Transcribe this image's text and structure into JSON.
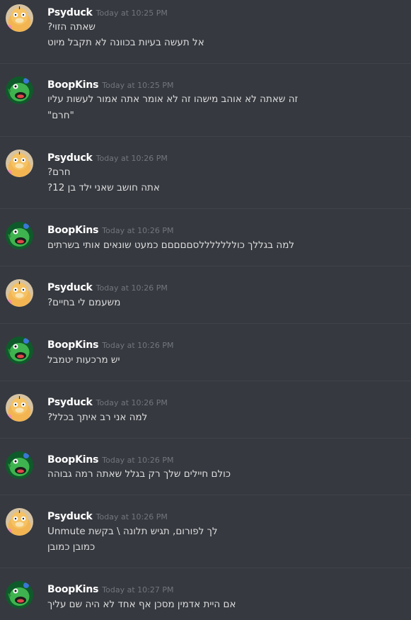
{
  "messages": [
    {
      "author": "Psyduck",
      "timestamp": "Today at 10:25 PM",
      "avatar": "psyduck-avatar",
      "lines": [
        "?שאתה הזוי",
        "אל תעשה בעיות בכוונה לא תקבל מיוט"
      ]
    },
    {
      "author": "BoopKins",
      "timestamp": "Today at 10:25 PM",
      "avatar": "green-dragon-avatar",
      "lines": [
        "זה שאתה לא אוהב מישהו זה לא אומר אתה אמור לעשות עליו",
        "\"חרם\""
      ]
    },
    {
      "author": "Psyduck",
      "timestamp": "Today at 10:26 PM",
      "avatar": "psyduck-avatar",
      "lines": [
        "?חרם",
        "?אתה חושב שאני ילד בן 12"
      ]
    },
    {
      "author": "BoopKins",
      "timestamp": "Today at 10:26 PM",
      "avatar": "green-dragon-avatar",
      "lines": [
        "למה בגללך כולללללללסםםםםם כמעט שונאים אותי בשרתים"
      ]
    },
    {
      "author": "Psyduck",
      "timestamp": "Today at 10:26 PM",
      "avatar": "psyduck-avatar",
      "lines": [
        "?משעמם לי בחיים"
      ]
    },
    {
      "author": "BoopKins",
      "timestamp": "Today at 10:26 PM",
      "avatar": "green-dragon-avatar",
      "lines": [
        "יש מרכעות יטמבל"
      ]
    },
    {
      "author": "Psyduck",
      "timestamp": "Today at 10:26 PM",
      "avatar": "psyduck-avatar",
      "lines": [
        "?למה אני רב איתך בכלל"
      ]
    },
    {
      "author": "BoopKins",
      "timestamp": "Today at 10:26 PM",
      "avatar": "green-dragon-avatar",
      "lines": [
        "כולם חיילים שלך רק בגלל שאתה רמה גבוהה"
      ]
    },
    {
      "author": "Psyduck",
      "timestamp": "Today at 10:26 PM",
      "avatar": "psyduck-avatar",
      "lines": [
        "Unmute לך לפורום, תגיש תלונה \\ בקשת",
        "כמובן כמובן"
      ]
    },
    {
      "author": "BoopKins",
      "timestamp": "Today at 10:27 PM",
      "avatar": "green-dragon-avatar",
      "lines": [
        "אם היית אדמין מסכן אף אחד לא היה שם עליך"
      ]
    }
  ],
  "colors": {
    "background": "#36393f",
    "divider": "#40444b",
    "username": "#ffffff",
    "timestamp": "#72767d",
    "message_text": "#dcddde"
  }
}
